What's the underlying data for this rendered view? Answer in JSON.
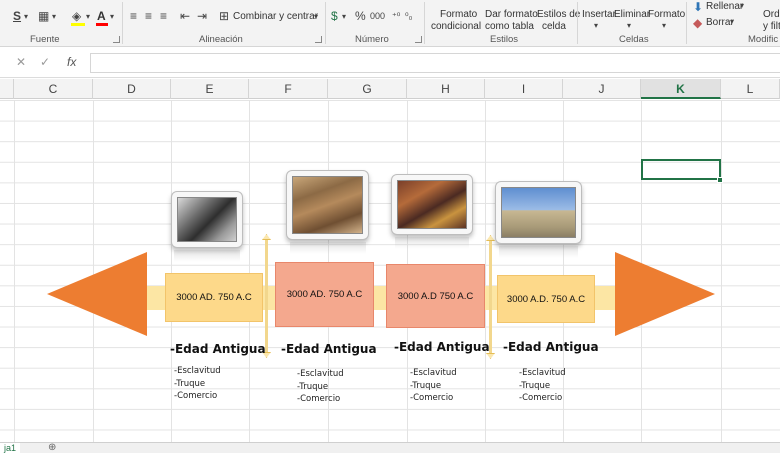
{
  "ribbon": {
    "font_group": {
      "label": "Fuente",
      "underline_label": "S",
      "fill_color": "#ffff00",
      "font_color": "#ff0000"
    },
    "align_group": {
      "label": "Alineación",
      "merge_label": "Combinar y centrar"
    },
    "number_group": {
      "label": "Número",
      "currency_symbol": "$",
      "percent_symbol": "%",
      "thousands_symbol": "000"
    },
    "styles_group": {
      "label": "Estilos",
      "conditional_line1": "Formato",
      "conditional_line2": "condicional",
      "table_line1": "Dar formato",
      "table_line2": "como tabla",
      "cell_styles_line1": "Estilos de",
      "cell_styles_line2": "celda"
    },
    "cells_group": {
      "label": "Celdas",
      "insert_label": "Insertar",
      "delete_label": "Eliminar",
      "format_label": "Formato"
    },
    "editing_group": {
      "label": "Modific",
      "fill_label": "Rellenar",
      "clear_label": "Borrar",
      "sort_line1": "Orde",
      "sort_line2": "y filtr"
    }
  },
  "formula_bar": {
    "cancel_icon": "✕",
    "enter_icon": "✓",
    "function_icon": "fx"
  },
  "columns": [
    "C",
    "D",
    "E",
    "F",
    "G",
    "H",
    "I",
    "J",
    "K",
    "L"
  ],
  "selected_column": "K",
  "timeline": {
    "arrow_color": "#ed7d31",
    "bar_color": "#fce6a4",
    "events": [
      {
        "date": "3000 AD. 750 A.C",
        "heading": "-Edad Antigua",
        "items": [
          "-Esclavitud",
          "-Truque",
          "-Comercio"
        ],
        "image": "steam-train-photo",
        "box_color": "#fdd98a"
      },
      {
        "date": "3000 AD. 750 A.C",
        "heading": "-Edad Antigua",
        "items": [
          "-Esclavitud",
          "-Truque",
          "-Comercio"
        ],
        "image": "school-of-athens-painting",
        "box_color": "#f4a88e"
      },
      {
        "date": "3000 A.D 750 A.C",
        "heading": "-Edad Antigua",
        "items": [
          "-Esclavitud",
          "-Truque",
          "-Comercio"
        ],
        "image": "council-painting",
        "box_color": "#f4a88e"
      },
      {
        "date": "3000 A.D. 750 A.C",
        "heading": "-Edad Antigua",
        "items": [
          "-Esclavitud",
          "-Truque",
          "-Comercio"
        ],
        "image": "parthenon-photo",
        "box_color": "#fdd98a"
      }
    ]
  },
  "sheet_tabs": {
    "active_label": "ja1",
    "add_icon": "⊕"
  }
}
